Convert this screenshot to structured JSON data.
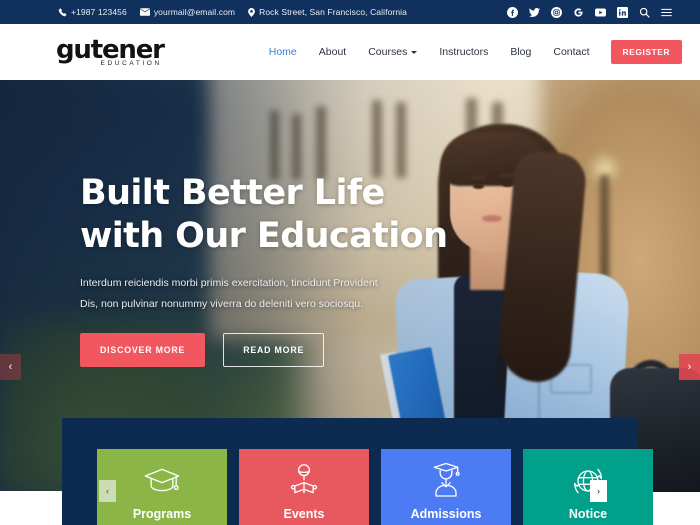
{
  "topbar": {
    "phone": "+1987 123456",
    "email": "yourmail@email.com",
    "address": "Rock Street, San Francisco, California",
    "phone_icon": "phone-icon",
    "email_icon": "envelope-icon",
    "address_icon": "location-pin-icon",
    "social": [
      {
        "name": "facebook-icon",
        "label": "Facebook"
      },
      {
        "name": "twitter-icon",
        "label": "Twitter"
      },
      {
        "name": "instagram-icon",
        "label": "Instagram"
      },
      {
        "name": "google-icon",
        "label": "Google"
      },
      {
        "name": "youtube-icon",
        "label": "YouTube"
      },
      {
        "name": "linkedin-icon",
        "label": "LinkedIn"
      }
    ],
    "search_icon": "search-icon",
    "menu_icon": "hamburger-menu-icon"
  },
  "header": {
    "logo_main": "gutener",
    "logo_sub": "EDUCATION",
    "nav": [
      {
        "label": "Home",
        "active": true,
        "dropdown": false
      },
      {
        "label": "About",
        "active": false,
        "dropdown": false
      },
      {
        "label": "Courses",
        "active": false,
        "dropdown": true
      },
      {
        "label": "Instructors",
        "active": false,
        "dropdown": false
      },
      {
        "label": "Blog",
        "active": false,
        "dropdown": false
      },
      {
        "label": "Contact",
        "active": false,
        "dropdown": false
      }
    ],
    "register_label": "REGISTER"
  },
  "hero": {
    "title_line1": "Built Better Life",
    "title_line2": "with Our Education",
    "sub_line1": "Interdum reiciendis morbi primis exercitation, tincidunt Provident",
    "sub_line2": "Dis, non pulvinar nonummy viverra do deleniti vero sociosqu.",
    "btn_primary": "DISCOVER MORE",
    "btn_secondary": "READ MORE",
    "prev_arrow": "‹",
    "next_arrow": "›"
  },
  "cards": {
    "prev_arrow": "‹",
    "next_arrow": "›",
    "items": [
      {
        "label": "Programs",
        "color": "#8cb548",
        "icon": "graduation-cap-icon"
      },
      {
        "label": "Events",
        "color": "#e8585f",
        "icon": "person-reading-book-icon"
      },
      {
        "label": "Admissions",
        "color": "#4d7bf3",
        "icon": "graduate-student-icon"
      },
      {
        "label": "Notice",
        "color": "#00a08a",
        "icon": "globe-refresh-icon"
      }
    ]
  },
  "colors": {
    "navy": "#10305e",
    "panel_navy": "#0d2a51",
    "accent_red": "#f2565f",
    "link_blue": "#3d7bd4"
  }
}
